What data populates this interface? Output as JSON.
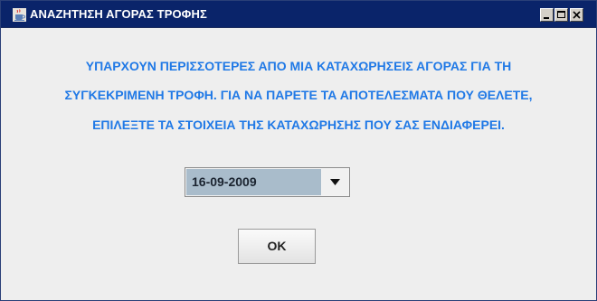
{
  "window": {
    "title": "ΑΝΑΖΗΤΗΣΗ ΑΓΟΡΑΣ ΤΡΟΦΗΣ",
    "icon": "java-coffee-cup-icon",
    "titlebar_color": "#0a246a"
  },
  "message": {
    "line1": "ΥΠΑΡΧΟΥΝ ΠΕΡΙΣΣΟΤΕΡΕΣ ΑΠΟ ΜΙΑ ΚΑΤΑΧΩΡΗΣΕΙΣ ΑΓΟΡΑΣ ΓΙΑ ΤΗ",
    "line2": "ΣΥΓΚΕΚΡΙΜΕΝΗ ΤΡΟΦΗ. ΓΙΑ ΝΑ ΠΑΡΕΤΕ ΤΑ ΑΠΟΤΕΛΕΣΜΑΤΑ ΠΟΥ ΘΕΛΕΤΕ,",
    "line3": "ΕΠΙΛΕΞΤΕ ΤΑ ΣΤΟΙΧΕΙΑ ΤΗΣ ΚΑΤΑΧΩΡΗΣΗΣ ΠΟΥ ΣΑΣ ΕΝΔΙΑΦΕΡΕΙ.",
    "color": "#2079e6"
  },
  "date_select": {
    "selected": "16-09-2009"
  },
  "ok_button": {
    "label": "OK"
  }
}
